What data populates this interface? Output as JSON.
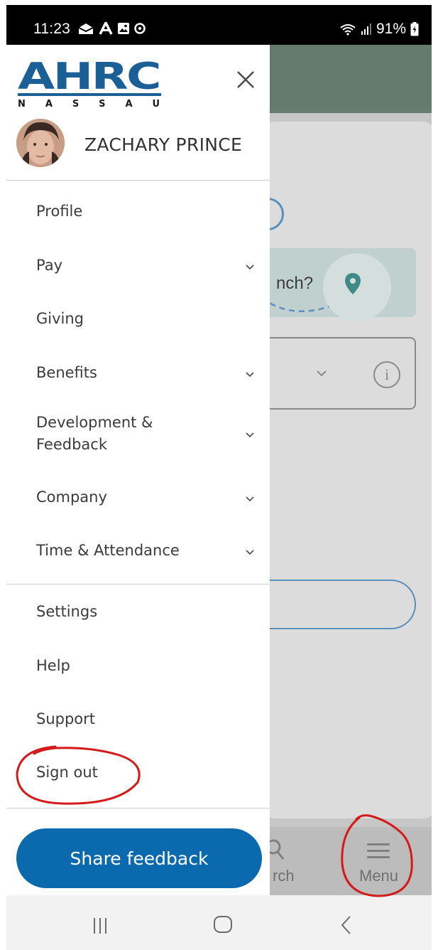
{
  "status_bar": {
    "time": "11:23",
    "battery": "91%"
  },
  "background": {
    "location_prompt_fragment": "nch?",
    "bottom_nav": {
      "search_fragment": "rch",
      "menu_label": "Menu"
    }
  },
  "drawer": {
    "logo_text": "AHRC",
    "logo_subtext": "N A S S A U",
    "user": {
      "name": "ZACHARY PRINCE"
    },
    "primary_items": [
      {
        "label": "Profile",
        "has_submenu": false
      },
      {
        "label": "Pay",
        "has_submenu": true
      },
      {
        "label": "Giving",
        "has_submenu": false
      },
      {
        "label": "Benefits",
        "has_submenu": true
      },
      {
        "label_line1": "Development &",
        "label_line2": "Feedback",
        "has_submenu": true
      },
      {
        "label": "Company",
        "has_submenu": true
      },
      {
        "label": "Time & Attendance",
        "has_submenu": true
      }
    ],
    "secondary_items": [
      {
        "label": "Settings"
      },
      {
        "label": "Help"
      },
      {
        "label": "Support"
      },
      {
        "label": "Sign out"
      }
    ],
    "share_button_label": "Share feedback"
  },
  "colors": {
    "brand_blue": "#0a6aad",
    "logo_blue": "#1a5f96",
    "header_green": "#667a6e",
    "annotation_red": "#d51a1a"
  },
  "icons": {
    "close": "close-icon",
    "chevron": "chevron-down-icon",
    "menu": "hamburger-icon",
    "search": "search-icon",
    "location": "map-pin-icon",
    "info": "info-icon"
  }
}
